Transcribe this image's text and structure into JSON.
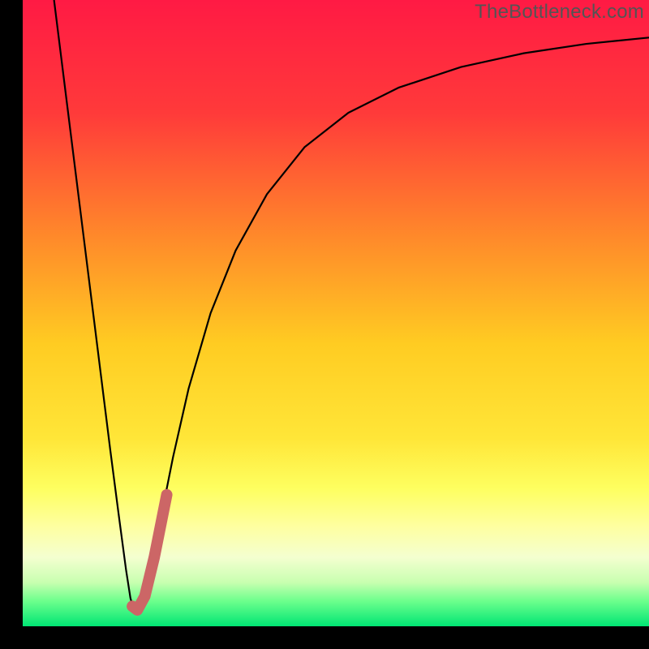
{
  "watermark": "TheBottleneck.com",
  "chart_data": {
    "type": "line",
    "title": "",
    "xlabel": "",
    "ylabel": "",
    "xlim": [
      0,
      100
    ],
    "ylim": [
      0,
      100
    ],
    "gradient_stops": [
      {
        "offset": 0,
        "color": "#ff1a44"
      },
      {
        "offset": 18,
        "color": "#ff3a3a"
      },
      {
        "offset": 38,
        "color": "#ff8a2a"
      },
      {
        "offset": 55,
        "color": "#ffcc22"
      },
      {
        "offset": 70,
        "color": "#ffe638"
      },
      {
        "offset": 78,
        "color": "#feff60"
      },
      {
        "offset": 84,
        "color": "#feffa0"
      },
      {
        "offset": 89,
        "color": "#f4ffd0"
      },
      {
        "offset": 93,
        "color": "#c8ffb0"
      },
      {
        "offset": 96,
        "color": "#6cff8c"
      },
      {
        "offset": 100,
        "color": "#00e574"
      }
    ],
    "series": [
      {
        "name": "black-curve",
        "color": "#000000",
        "width": 2.2,
        "points": [
          {
            "x": 5.0,
            "y": 100.0
          },
          {
            "x": 6.5,
            "y": 88.0
          },
          {
            "x": 8.0,
            "y": 76.0
          },
          {
            "x": 9.5,
            "y": 64.0
          },
          {
            "x": 11.0,
            "y": 52.0
          },
          {
            "x": 12.5,
            "y": 40.0
          },
          {
            "x": 14.0,
            "y": 28.0
          },
          {
            "x": 15.3,
            "y": 18.0
          },
          {
            "x": 16.5,
            "y": 9.0
          },
          {
            "x": 17.2,
            "y": 4.5
          },
          {
            "x": 17.7,
            "y": 2.8
          },
          {
            "x": 18.3,
            "y": 2.4
          },
          {
            "x": 19.2,
            "y": 4.0
          },
          {
            "x": 20.5,
            "y": 9.0
          },
          {
            "x": 22.0,
            "y": 17.0
          },
          {
            "x": 24.0,
            "y": 27.0
          },
          {
            "x": 26.5,
            "y": 38.0
          },
          {
            "x": 30.0,
            "y": 50.0
          },
          {
            "x": 34.0,
            "y": 60.0
          },
          {
            "x": 39.0,
            "y": 69.0
          },
          {
            "x": 45.0,
            "y": 76.5
          },
          {
            "x": 52.0,
            "y": 82.0
          },
          {
            "x": 60.0,
            "y": 86.0
          },
          {
            "x": 70.0,
            "y": 89.3
          },
          {
            "x": 80.0,
            "y": 91.5
          },
          {
            "x": 90.0,
            "y": 93.0
          },
          {
            "x": 100.0,
            "y": 94.0
          }
        ]
      },
      {
        "name": "red-highlight",
        "color": "#cc6666",
        "width": 14,
        "linecap": "round",
        "points": [
          {
            "x": 17.5,
            "y": 3.2
          },
          {
            "x": 18.3,
            "y": 2.6
          },
          {
            "x": 19.5,
            "y": 4.8
          },
          {
            "x": 21.0,
            "y": 11.0
          },
          {
            "x": 23.0,
            "y": 21.0
          }
        ]
      }
    ]
  }
}
